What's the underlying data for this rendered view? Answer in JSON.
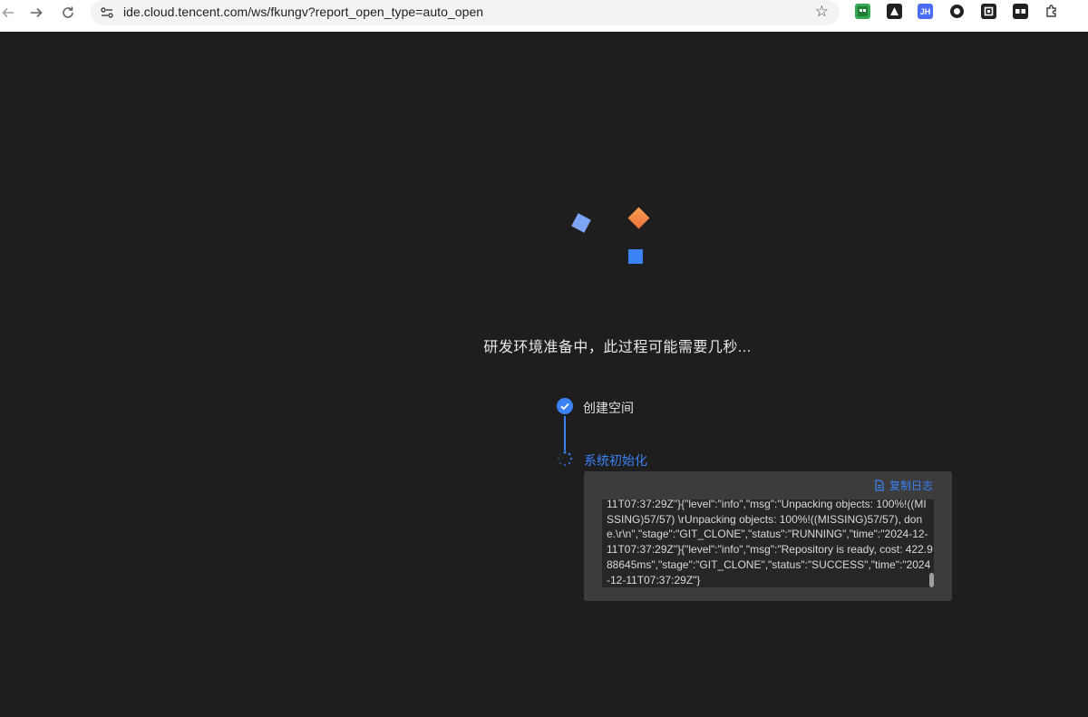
{
  "browser": {
    "url": "ide.cloud.tencent.com/ws/fkungv?report_open_type=auto_open",
    "extensions": [
      {
        "name": "ext-green",
        "label": "",
        "color": "#34a853"
      },
      {
        "name": "ext-triangle",
        "label": "",
        "color": "#202124"
      },
      {
        "name": "ext-jh",
        "label": "JH",
        "color": "#4a6cf7"
      },
      {
        "name": "ext-circle",
        "label": "",
        "color": "#202124"
      },
      {
        "name": "ext-square",
        "label": "",
        "color": "#202124"
      },
      {
        "name": "ext-mask",
        "label": "",
        "color": "#202124"
      },
      {
        "name": "extensions-puzzle",
        "label": "",
        "color": "#5f6368"
      }
    ]
  },
  "main": {
    "heading": "研发环境准备中，此过程可能需要几秒...",
    "steps": [
      {
        "label": "创建空间",
        "status": "done",
        "color": "#e0e0e0"
      },
      {
        "label": "系统初始化",
        "status": "loading",
        "color": "#3b82f6"
      }
    ],
    "log": {
      "copy_label": "复制日志",
      "text": "11T07:37:29Z\"}{\"level\":\"info\",\"msg\":\"Unpacking objects: 100%!((MISSING)57/57) \\rUnpacking objects: 100%!((MISSING)57/57), done.\\r\\n\",\"stage\":\"GIT_CLONE\",\"status\":\"RUNNING\",\"time\":\"2024-12-11T07:37:29Z\"}{\"level\":\"info\",\"msg\":\"Repository is ready, cost: 422.988645ms\",\"stage\":\"GIT_CLONE\",\"status\":\"SUCCESS\",\"time\":\"2024-12-11T07:37:29Z\"}"
    }
  },
  "colors": {
    "accent": "#3b82f6",
    "shape_light": "#7da4f5",
    "shape_orange": "#f5894a",
    "shape_blue": "#3b82f6"
  }
}
